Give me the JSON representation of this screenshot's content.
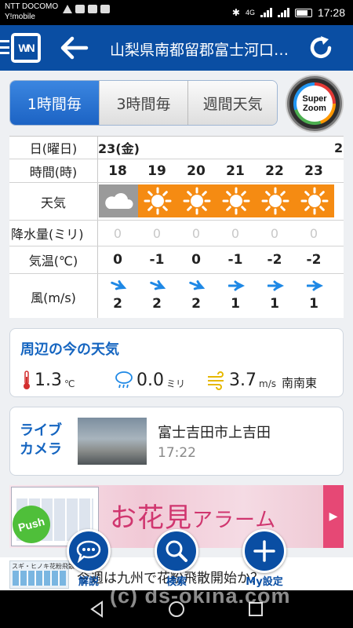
{
  "status_bar": {
    "carrier_line1": "NTT DOCOMO",
    "carrier_line2": "Y!mobile",
    "signal_label": "4G",
    "time": "17:28"
  },
  "header": {
    "logo_text": "WN",
    "title": "山梨県南都留郡富士河口湖町",
    "back_icon": "arrow-left",
    "refresh_icon": "refresh"
  },
  "tabs": [
    {
      "label": "1時間毎",
      "active": true
    },
    {
      "label": "3時間毎",
      "active": false
    },
    {
      "label": "週間天気",
      "active": false
    }
  ],
  "superzoom": {
    "line1": "Super",
    "line2": "Zoom"
  },
  "forecast": {
    "labels": {
      "date": "日(曜日)",
      "time": "時間(時)",
      "weather": "天気",
      "precip": "降水量(ミリ)",
      "temp": "気温(℃)",
      "wind": "風(m/s)"
    },
    "date_main": "23(金)",
    "date_next": "2",
    "hours": [
      "18",
      "19",
      "20",
      "21",
      "22",
      "23"
    ],
    "weather": [
      "cloudy",
      "sunny",
      "sunny",
      "sunny",
      "sunny",
      "sunny"
    ],
    "precip": [
      "0",
      "0",
      "0",
      "0",
      "0",
      "0"
    ],
    "temp": [
      "0",
      "-1",
      "0",
      "-1",
      "-2",
      "-2"
    ],
    "wind_speed": [
      "2",
      "2",
      "2",
      "1",
      "1",
      "1"
    ],
    "wind_direction": [
      "SE",
      "SE",
      "SE",
      "E",
      "E",
      "E"
    ],
    "colors": {
      "sunny": "#f58b12",
      "cloudy": "#9a9a9a"
    }
  },
  "current": {
    "title": "周辺の今の天気",
    "temp_value": "1.3",
    "temp_unit": "℃",
    "rain_value": "0.0",
    "rain_unit": "ミリ",
    "wind_value": "3.7",
    "wind_unit": "m/s",
    "wind_dir": "南南東"
  },
  "camera": {
    "label_line1": "ライブ",
    "label_line2": "カメラ",
    "place": "富士吉田市上吉田",
    "time": "17:22"
  },
  "banner": {
    "title_main": "お花見",
    "title_small": "アラーム",
    "push_label": "Push",
    "arrow": "▶"
  },
  "ad": {
    "thumb_title": "スギ・ヒノキ花粉飛散予報",
    "text": "今週は九州で花粉飛散開始か？"
  },
  "fabs": [
    {
      "label": "解説",
      "icon": "speech-bubble"
    },
    {
      "label": "検索",
      "icon": "magnifier"
    },
    {
      "label": "My設定",
      "icon": "plus"
    }
  ],
  "watermark": "(c) ds-okina.com",
  "accent_color": "#0a4ea3"
}
